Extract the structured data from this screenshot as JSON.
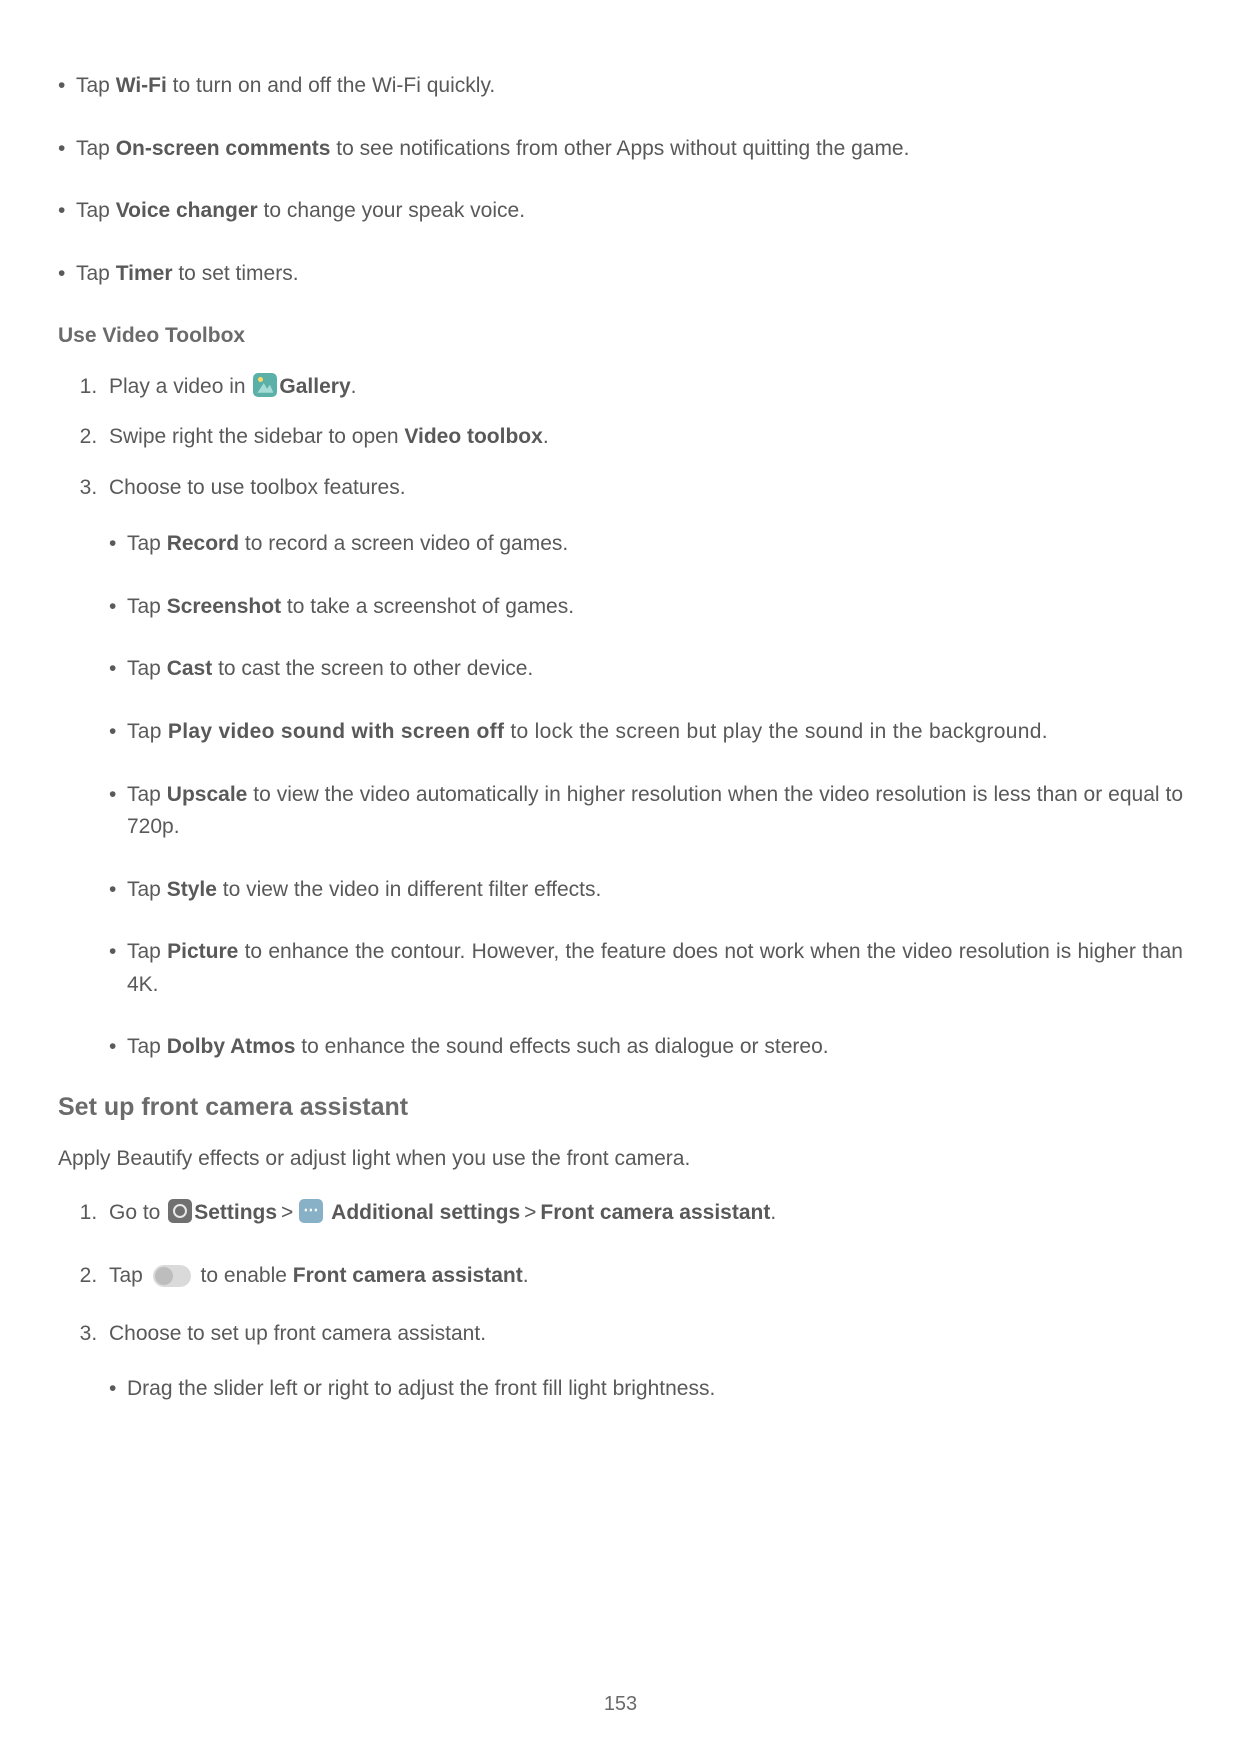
{
  "topBullets": [
    {
      "pre": "Tap ",
      "bold": "Wi-Fi",
      "post": " to turn on and off the Wi-Fi quickly."
    },
    {
      "pre": "Tap ",
      "bold": "On-screen comments",
      "post": " to see notifications from other Apps without quitting the game."
    },
    {
      "pre": "Tap ",
      "bold": "Voice changer",
      "post": " to change your speak voice."
    },
    {
      "pre": "Tap ",
      "bold": "Timer",
      "post": " to set timers."
    }
  ],
  "videoToolbox": {
    "heading": "Use Video Toolbox",
    "steps": [
      {
        "pre": "Play a video in ",
        "icon": "gallery",
        "bold": "Gallery",
        "post": "."
      },
      {
        "pre": "Swipe right the sidebar to open ",
        "bold": "Video toolbox",
        "post": "."
      },
      {
        "pre": "Choose to use toolbox features.",
        "sub": [
          {
            "pre": "Tap ",
            "bold": "Record",
            "post": " to record a screen video of games."
          },
          {
            "pre": "Tap ",
            "bold": "Screenshot",
            "post": " to take a screenshot of games."
          },
          {
            "pre": "Tap ",
            "bold": "Cast",
            "post": " to cast the screen to other device."
          },
          {
            "pre": "Tap ",
            "bold": "Play video sound with screen off",
            "post": " to lock the screen but play the sound in the background.",
            "justify": true,
            "spaced": true
          },
          {
            "pre": "Tap ",
            "bold": "Upscale",
            "post": " to view the video automatically in higher resolution when the video resolution is less than or equal to 720p.",
            "justify": true
          },
          {
            "pre": "Tap ",
            "bold": "Style",
            "post": " to view the video in different filter effects."
          },
          {
            "pre": "Tap ",
            "bold": "Picture",
            "post": " to enhance the contour. However, the feature does not work when the video resolution is higher than 4K.",
            "justify": true
          },
          {
            "pre": "Tap ",
            "bold": "Dolby Atmos",
            "post": " to enhance the sound effects such as dialogue or stereo."
          }
        ]
      }
    ]
  },
  "frontCamera": {
    "heading": "Set up front camera assistant",
    "intro": "Apply Beautify effects or adjust light when you use the front camera.",
    "steps": {
      "goTo": {
        "pre": "Go to ",
        "settings": "Settings",
        "sep": ">",
        "additional": "Additional settings",
        "last": "Front camera assistant",
        "post": "."
      },
      "tapToggle": {
        "pre": "Tap ",
        "mid": " to enable ",
        "bold": "Front camera assistant",
        "post": "."
      },
      "choose": {
        "text": "Choose to set up front camera assistant.",
        "sub": [
          {
            "text": "Drag the slider left or right to adjust the front fill light brightness."
          }
        ]
      }
    }
  },
  "pageNumber": "153"
}
